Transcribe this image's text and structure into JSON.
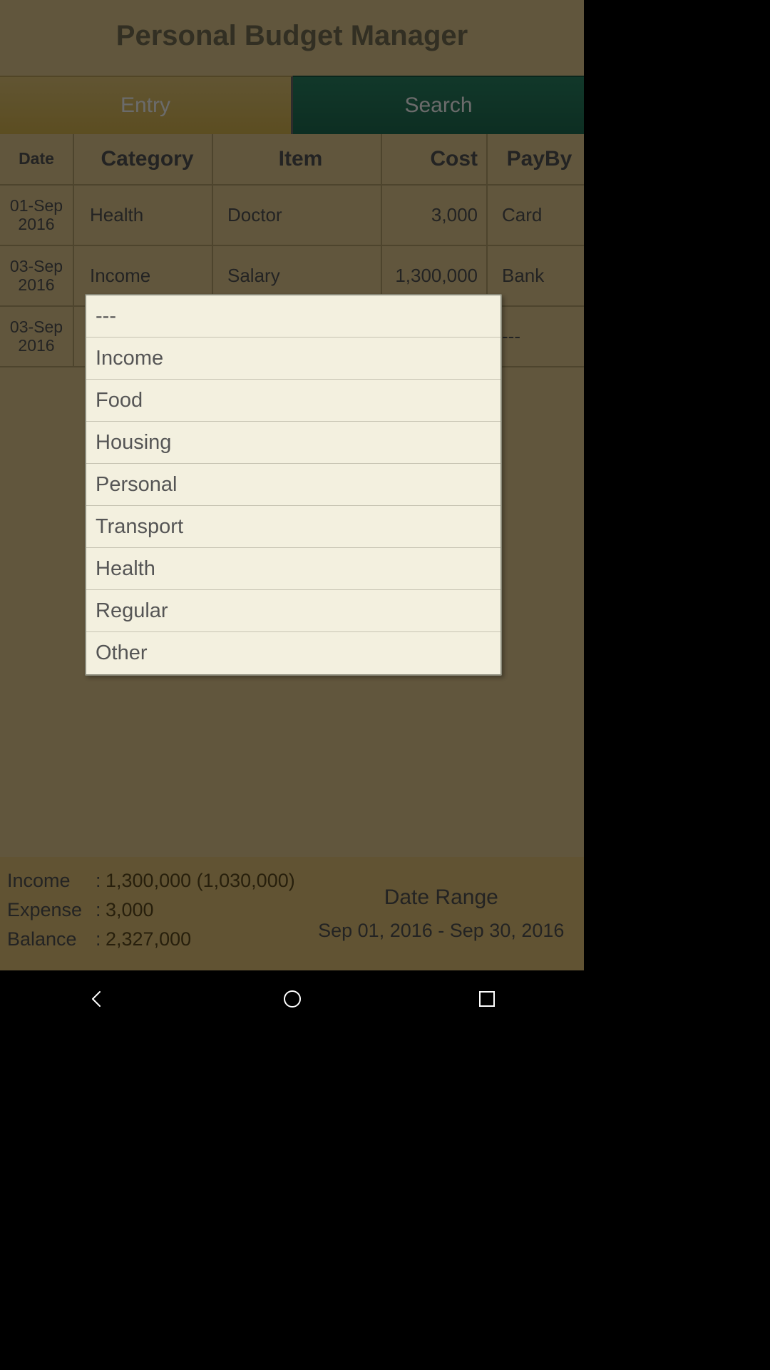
{
  "header": {
    "title": "Personal Budget Manager"
  },
  "tabs": {
    "entry": "Entry",
    "search": "Search"
  },
  "columns": {
    "date": "Date",
    "category": "Category",
    "item": "Item",
    "cost": "Cost",
    "payby": "PayBy"
  },
  "rows": [
    {
      "date_top": "01-Sep",
      "date_bot": "2016",
      "category": "Health",
      "item": "Doctor",
      "cost": "3,000",
      "payby": "Card"
    },
    {
      "date_top": "03-Sep",
      "date_bot": "2016",
      "category": "Income",
      "item": "Salary",
      "cost": "1,300,000",
      "payby": "Bank"
    },
    {
      "date_top": "03-Sep",
      "date_bot": "2016",
      "category": "",
      "item": "",
      "cost": "",
      "payby": "---"
    }
  ],
  "summary": {
    "income_label": "Income",
    "income_value": "1,300,000 (1,030,000)",
    "expense_label": "Expense",
    "expense_value": "3,000",
    "balance_label": "Balance",
    "balance_value": "2,327,000",
    "date_range_label": "Date Range",
    "date_range_value": "Sep 01, 2016  -  Sep 30, 2016"
  },
  "dropdown": {
    "items": [
      {
        "label": "---"
      },
      {
        "label": "Income"
      },
      {
        "label": "Food"
      },
      {
        "label": "Housing"
      },
      {
        "label": "Personal"
      },
      {
        "label": "Transport"
      },
      {
        "label": "Health"
      },
      {
        "label": "Regular"
      },
      {
        "label": "Other"
      }
    ]
  }
}
